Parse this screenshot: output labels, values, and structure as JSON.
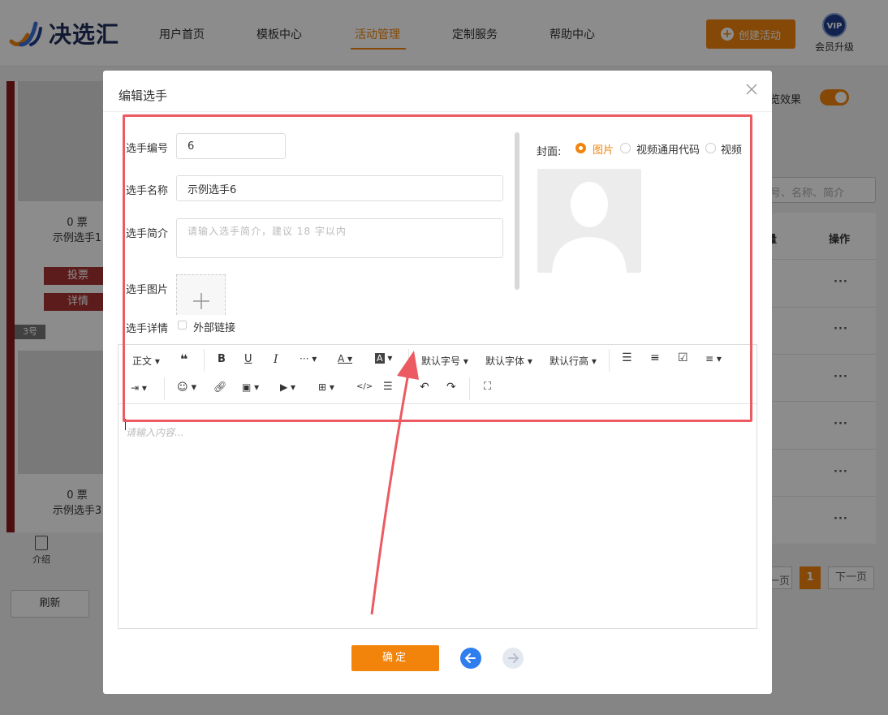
{
  "nav": {
    "logo_text": "决选汇",
    "items": [
      {
        "label": "用户首页"
      },
      {
        "label": "模板中心"
      },
      {
        "label": "活动管理"
      },
      {
        "label": "定制服务"
      },
      {
        "label": "帮助中心"
      }
    ],
    "create_label": "创建活动",
    "vip_badge": "VIP",
    "vip_label": "会员升级",
    "accent": "#f2840c"
  },
  "background": {
    "card1": {
      "votes": "0 票",
      "name": "示例选手1",
      "vote_btn": "投票",
      "detail_btn": "详情"
    },
    "card3": {
      "badge": "3号",
      "votes": "0 票",
      "name": "示例选手3"
    },
    "intro_tab": "介绍",
    "refresh": "刷新",
    "preview_label": "览效果",
    "search_placeholder": "号、名称、简介",
    "col_vote": "量",
    "col_action": "操作",
    "row_action": "···",
    "pager": {
      "prev": "一页",
      "current": "1",
      "next": "下一页"
    }
  },
  "modal": {
    "title": "编辑选手",
    "fields": {
      "number_label": "选手编号",
      "number_value": "6",
      "name_label": "选手名称",
      "name_value": "示例选手6",
      "intro_label": "选手简介",
      "intro_placeholder": "请输入选手简介，建议 18 字以内",
      "image_label": "选手图片",
      "detail_label": "选手详情",
      "external_link_label": "外部链接"
    },
    "cover": {
      "label": "封面:",
      "options": [
        "图片",
        "视频通用代码",
        "视频"
      ],
      "selected": "图片"
    },
    "editor": {
      "toolbar": {
        "paragraph": "正文",
        "font_size": "默认字号",
        "font_family": "默认字体",
        "line_height": "默认行高"
      },
      "placeholder": "请输入内容..."
    },
    "confirm": "确定"
  },
  "annotation_color": "#ec5a62"
}
